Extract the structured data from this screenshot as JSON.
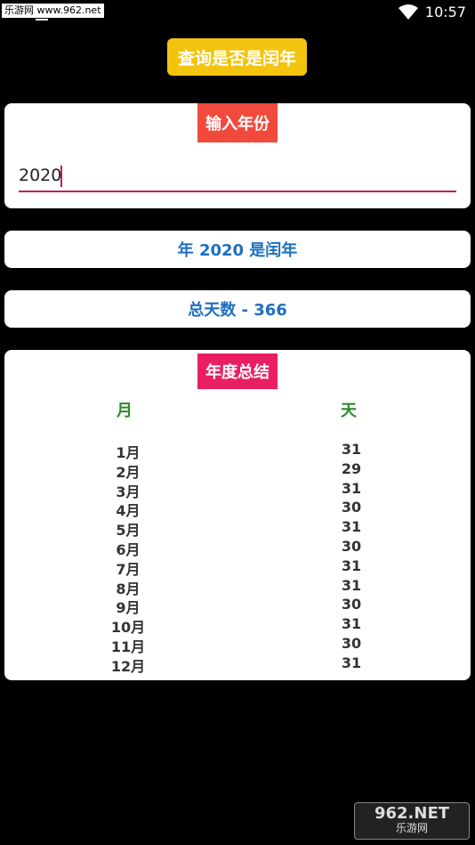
{
  "status_bar": {
    "watermark": "乐游网 www.962.net",
    "time": "10:57"
  },
  "header": {
    "check_button": "查询是否是闰年"
  },
  "input_card": {
    "label": "输入年份",
    "value": "2020"
  },
  "result": {
    "text": "年 2020 是闰年"
  },
  "days": {
    "text": "总天数 - 366"
  },
  "summary": {
    "label": "年度总结",
    "month_header": "月",
    "day_header": "天",
    "rows": [
      {
        "month": "1月",
        "days": "31"
      },
      {
        "month": "2月",
        "days": "29"
      },
      {
        "month": "3月",
        "days": "31"
      },
      {
        "month": "4月",
        "days": "30"
      },
      {
        "month": "5月",
        "days": "31"
      },
      {
        "month": "6月",
        "days": "30"
      },
      {
        "month": "7月",
        "days": "31"
      },
      {
        "month": "8月",
        "days": "31"
      },
      {
        "month": "9月",
        "days": "30"
      },
      {
        "month": "10月",
        "days": "31"
      },
      {
        "month": "11月",
        "days": "30"
      },
      {
        "month": "12月",
        "days": "31"
      }
    ]
  },
  "corner_logo": {
    "text": "962.NET",
    "sub": "乐游网"
  },
  "colors": {
    "check_button": "#f2c40f",
    "input_label": "#f14a3d",
    "summary_label": "#e91e63",
    "result_text": "#1e6fbf",
    "column_header": "#2e8b2e",
    "input_underline": "#c2185b"
  }
}
